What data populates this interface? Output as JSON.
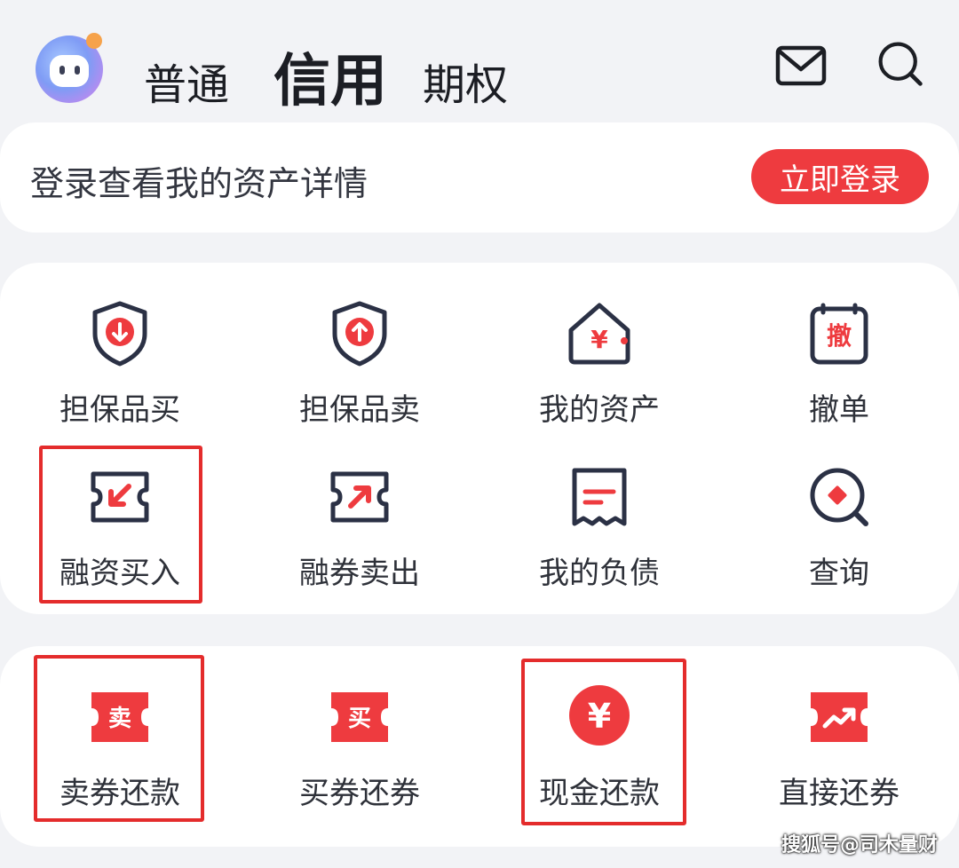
{
  "header": {
    "tabs": [
      "普通",
      "信用",
      "期权"
    ],
    "active_tab": "信用"
  },
  "login": {
    "prompt": "登录查看我的资产详情",
    "button": "立即登录"
  },
  "main_grid": {
    "items": [
      {
        "label": "担保品买",
        "icon": "shield-down-icon"
      },
      {
        "label": "担保品卖",
        "icon": "shield-up-icon"
      },
      {
        "label": "我的资产",
        "icon": "house-yen-icon"
      },
      {
        "label": "撤单",
        "icon": "cancel-order-icon",
        "glyph": "撤"
      },
      {
        "label": "融资买入",
        "icon": "ticket-arrow-in-icon"
      },
      {
        "label": "融券卖出",
        "icon": "ticket-arrow-out-icon"
      },
      {
        "label": "我的负债",
        "icon": "receipt-icon"
      },
      {
        "label": "查询",
        "icon": "magnifier-diamond-icon"
      }
    ]
  },
  "repay_grid": {
    "items": [
      {
        "label": "卖券还款",
        "icon": "sell-ticket-icon",
        "glyph": "卖"
      },
      {
        "label": "买券还券",
        "icon": "buy-ticket-icon",
        "glyph": "买"
      },
      {
        "label": "现金还款",
        "icon": "cash-yen-icon",
        "glyph": "¥"
      },
      {
        "label": "直接还券",
        "icon": "direct-return-icon"
      }
    ]
  },
  "watermark": "搜狐号@司木量财",
  "colors": {
    "accent": "#ee3b3f",
    "icon_stroke": "#2b3145",
    "highlight": "#e42c2c",
    "background": "#f2f3f6"
  }
}
